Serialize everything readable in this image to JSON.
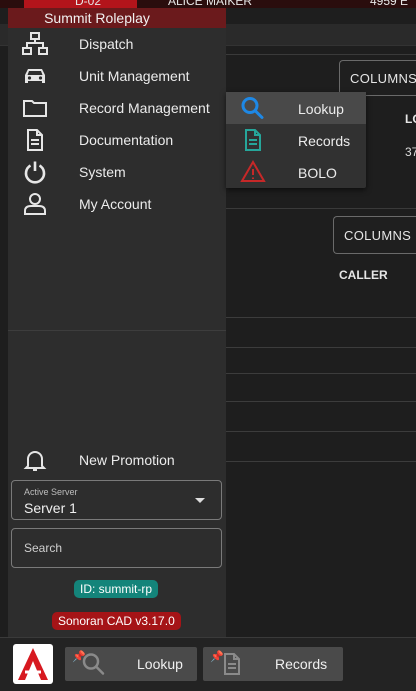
{
  "background": {
    "top_unit": "D-02",
    "top_name": "ALICE MAIKER",
    "top_extra": "4959 E",
    "panel1": {
      "columns_label": "COLUMNS",
      "col_head": "LO",
      "cell_value": "37"
    },
    "panel2": {
      "columns_label": "COLUMNS",
      "col_head": "CALLER"
    }
  },
  "drawer": {
    "title": "Summit Roleplay",
    "nav": [
      {
        "label": "Dispatch",
        "icon": "network-icon"
      },
      {
        "label": "Unit Management",
        "icon": "car-icon"
      },
      {
        "label": "Record Management",
        "icon": "folder-icon"
      },
      {
        "label": "Documentation",
        "icon": "document-icon"
      },
      {
        "label": "System",
        "icon": "power-icon"
      },
      {
        "label": "My Account",
        "icon": "user-icon"
      }
    ],
    "promotion": {
      "label": "New Promotion",
      "icon": "bell-icon"
    },
    "server": {
      "caption": "Active Server",
      "value": "Server 1"
    },
    "search": {
      "placeholder": "Search"
    },
    "id_badge": "ID: summit-rp",
    "version_badge": "Sonoran CAD v3.17.0"
  },
  "flyout": {
    "items": [
      {
        "label": "Lookup",
        "icon": "search-icon",
        "active": true
      },
      {
        "label": "Records",
        "icon": "records-icon"
      },
      {
        "label": "BOLO",
        "icon": "warning-icon"
      }
    ]
  },
  "taskbar": {
    "buttons": [
      {
        "label": "Lookup",
        "icon": "search-icon"
      },
      {
        "label": "Records",
        "icon": "records-icon"
      }
    ]
  },
  "colors": {
    "header": "#6b1a1c",
    "drawer": "#2d2d2d",
    "id_badge": "#14847a",
    "version_badge": "#a51417",
    "lookup_icon": "#1e88e5",
    "records_icon": "#26a69a",
    "bolo_icon": "#c62828"
  }
}
